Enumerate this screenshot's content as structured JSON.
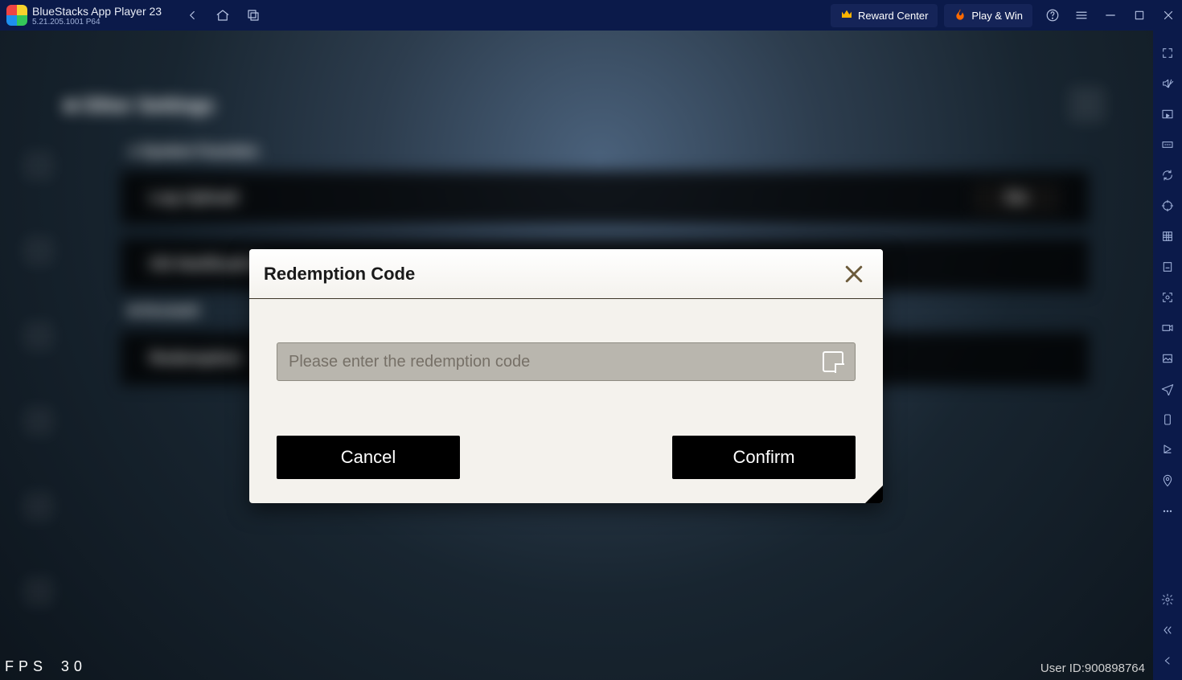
{
  "titlebar": {
    "app_name": "BlueStacks App Player 23",
    "version": "5.21.205.1001  P64",
    "reward_label": "Reward Center",
    "play_label": "Play & Win"
  },
  "game": {
    "settings_title": "Other Settings",
    "section_label": "System Function",
    "panel1": "Log Upload",
    "panel1_action": "Go",
    "panel2": "OS Notification",
    "sub_section": "Account",
    "subpanel": "Redemption",
    "fps_label": "FPS",
    "fps_value": "30",
    "user_id_label": "User ID:",
    "user_id_value": "900898764"
  },
  "modal": {
    "title": "Redemption Code",
    "placeholder": "Please enter the redemption code",
    "cancel": "Cancel",
    "confirm": "Confirm"
  }
}
